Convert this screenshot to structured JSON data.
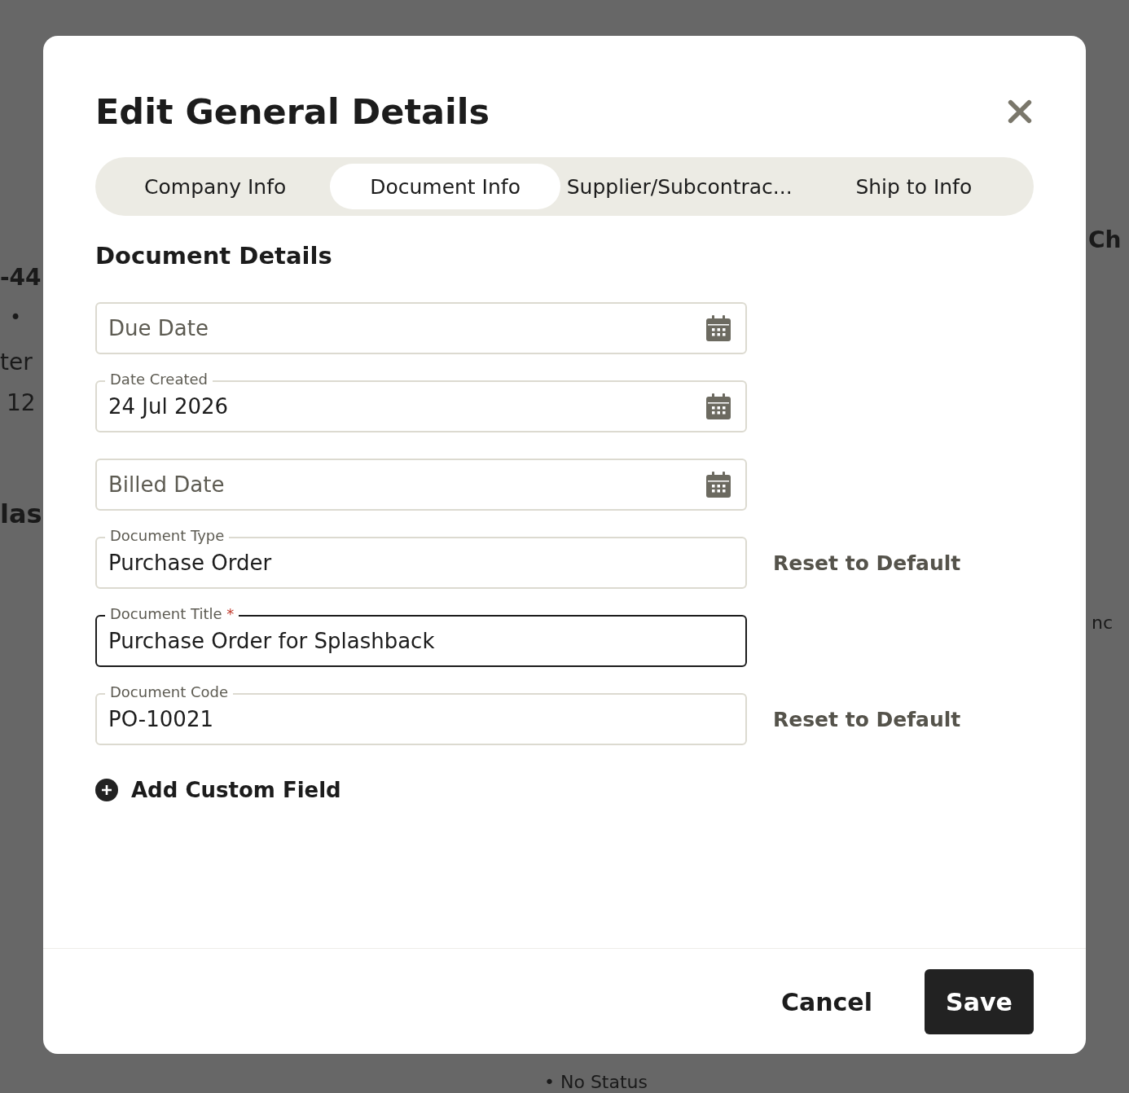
{
  "background": {
    "fragments": [
      {
        "text": "-44"
      },
      {
        "text": "•"
      },
      {
        "text": "ter"
      },
      {
        "text": "12"
      },
      {
        "text": "las"
      },
      {
        "text": "Ch"
      },
      {
        "text": "nc"
      },
      {
        "text": "• No Status"
      }
    ]
  },
  "dialog": {
    "title": "Edit General Details",
    "tabs": [
      {
        "label": "Company Info",
        "selected": false
      },
      {
        "label": "Document Info",
        "selected": true
      },
      {
        "label": "Supplier/Subcontrac...",
        "selected": false
      },
      {
        "label": "Ship to Info",
        "selected": false
      }
    ],
    "section_title": "Document Details",
    "fields": [
      {
        "kind": "date",
        "placeholder": "Due Date"
      },
      {
        "kind": "date",
        "label": "Date Created",
        "value": "24 Jul 2026"
      },
      {
        "kind": "date",
        "placeholder": "Billed Date"
      },
      {
        "kind": "text",
        "label": "Document Type",
        "value": "Purchase Order",
        "action": "Reset to Default"
      },
      {
        "kind": "text",
        "label": "Document Title",
        "required_mark": "*",
        "value": "Purchase Order for Splashback",
        "focused": true
      },
      {
        "kind": "text",
        "label": "Document Code",
        "value": "PO-10021",
        "action": "Reset to Default"
      }
    ],
    "add_field": "Add Custom Field",
    "buttons": {
      "cancel": "Cancel",
      "save": "Save"
    }
  }
}
